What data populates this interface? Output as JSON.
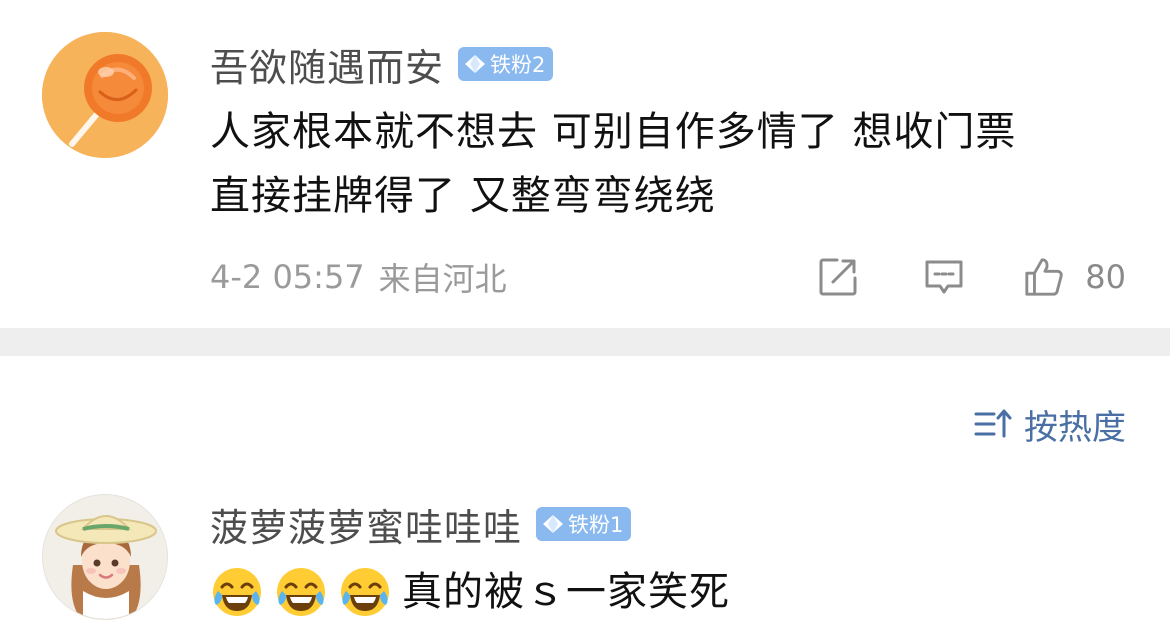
{
  "comments": [
    {
      "avatar_icon": "lollipop-avatar",
      "username": "吾欲随遇而安",
      "badge": "铁粉2",
      "content_lines": [
        "人家根本就不想去 可别自作多情了 想收门票",
        "直接挂牌得了 又整弯弯绕绕"
      ],
      "date": "4-2 05:57",
      "location": "来自河北",
      "share_icon": "share-icon",
      "reply_icon": "comment-icon",
      "like_icon": "thumbs-up-icon",
      "likes": "80"
    },
    {
      "avatar_icon": "girl-with-hat-avatar",
      "username": "菠萝菠萝蜜哇哇哇",
      "badge": "铁粉1",
      "emojis": [
        "laughing-crying-emoji",
        "laughing-crying-emoji",
        "laughing-crying-emoji"
      ],
      "content": "真的被ｓ一家笑死"
    }
  ],
  "sort": {
    "icon": "sort-icon",
    "label": "按热度"
  },
  "colors": {
    "badge": "#8ab9f0",
    "sort_accent": "#4a6fa5",
    "divider": "#eeeeee",
    "meta_text": "#9a9a9a"
  }
}
